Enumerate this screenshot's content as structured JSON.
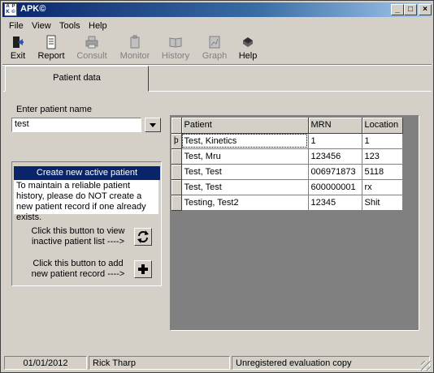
{
  "window": {
    "title": "APK©",
    "minimize": "_",
    "restore": "□",
    "close": "×"
  },
  "menu": [
    "File",
    "View",
    "Tools",
    "Help"
  ],
  "toolbar": [
    {
      "label": "Exit",
      "icon": "exit-door-icon",
      "enabled": true
    },
    {
      "label": "Report",
      "icon": "report-document-icon",
      "enabled": true
    },
    {
      "label": "Consult",
      "icon": "printer-icon",
      "enabled": false
    },
    {
      "label": "Monitor",
      "icon": "clipboard-icon",
      "enabled": false
    },
    {
      "label": "History",
      "icon": "book-icon",
      "enabled": false
    },
    {
      "label": "Graph",
      "icon": "graph-icon",
      "enabled": false
    },
    {
      "label": "Help",
      "icon": "help-book-icon",
      "enabled": true
    }
  ],
  "tab": {
    "label": "Patient data"
  },
  "patient_search": {
    "label": "Enter patient name",
    "value": "test"
  },
  "create_panel": {
    "header": "Create new active patient",
    "notice": "To maintain a reliable patient history, please do NOT create a new patient record if one already exists.",
    "inactive_hint": "Click this button to view inactive patient list ---->",
    "add_hint": "Click this button to add new patient record ---->"
  },
  "grid": {
    "columns": [
      "Patient",
      "MRN",
      "Location"
    ],
    "rows": [
      {
        "patient": "Test, Kinetics",
        "mrn": "1",
        "location": "1"
      },
      {
        "patient": "Test, Mru",
        "mrn": "123456",
        "location": "123"
      },
      {
        "patient": "Test, Test",
        "mrn": "006971873",
        "location": "5118"
      },
      {
        "patient": "Test, Test",
        "mrn": "600000001",
        "location": "rx"
      },
      {
        "patient": "Testing, Test2",
        "mrn": "12345",
        "location": "Shit"
      }
    ],
    "current_row_marker": "þ"
  },
  "status": {
    "date": "01/01/2012",
    "user": "Rick Tharp",
    "license": "Unregistered evaluation copy"
  },
  "colors": {
    "title_active": "#0a246a",
    "face": "#d4d0c8"
  }
}
